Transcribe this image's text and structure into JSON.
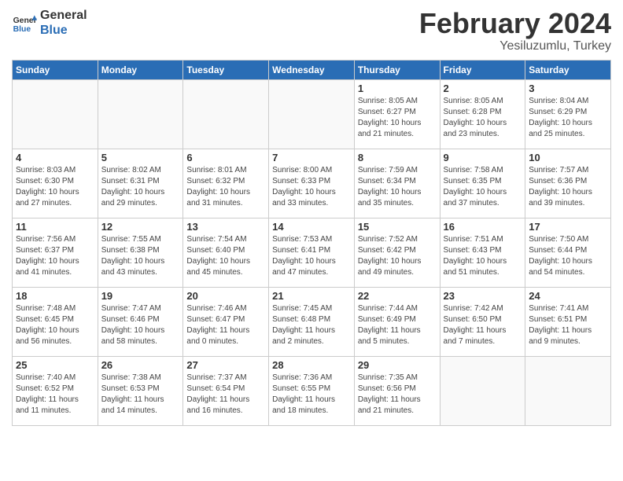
{
  "header": {
    "logo_line1": "General",
    "logo_line2": "Blue",
    "month": "February 2024",
    "location": "Yesiluzumlu, Turkey"
  },
  "weekdays": [
    "Sunday",
    "Monday",
    "Tuesday",
    "Wednesday",
    "Thursday",
    "Friday",
    "Saturday"
  ],
  "weeks": [
    [
      {
        "day": "",
        "info": ""
      },
      {
        "day": "",
        "info": ""
      },
      {
        "day": "",
        "info": ""
      },
      {
        "day": "",
        "info": ""
      },
      {
        "day": "1",
        "info": "Sunrise: 8:05 AM\nSunset: 6:27 PM\nDaylight: 10 hours\nand 21 minutes."
      },
      {
        "day": "2",
        "info": "Sunrise: 8:05 AM\nSunset: 6:28 PM\nDaylight: 10 hours\nand 23 minutes."
      },
      {
        "day": "3",
        "info": "Sunrise: 8:04 AM\nSunset: 6:29 PM\nDaylight: 10 hours\nand 25 minutes."
      }
    ],
    [
      {
        "day": "4",
        "info": "Sunrise: 8:03 AM\nSunset: 6:30 PM\nDaylight: 10 hours\nand 27 minutes."
      },
      {
        "day": "5",
        "info": "Sunrise: 8:02 AM\nSunset: 6:31 PM\nDaylight: 10 hours\nand 29 minutes."
      },
      {
        "day": "6",
        "info": "Sunrise: 8:01 AM\nSunset: 6:32 PM\nDaylight: 10 hours\nand 31 minutes."
      },
      {
        "day": "7",
        "info": "Sunrise: 8:00 AM\nSunset: 6:33 PM\nDaylight: 10 hours\nand 33 minutes."
      },
      {
        "day": "8",
        "info": "Sunrise: 7:59 AM\nSunset: 6:34 PM\nDaylight: 10 hours\nand 35 minutes."
      },
      {
        "day": "9",
        "info": "Sunrise: 7:58 AM\nSunset: 6:35 PM\nDaylight: 10 hours\nand 37 minutes."
      },
      {
        "day": "10",
        "info": "Sunrise: 7:57 AM\nSunset: 6:36 PM\nDaylight: 10 hours\nand 39 minutes."
      }
    ],
    [
      {
        "day": "11",
        "info": "Sunrise: 7:56 AM\nSunset: 6:37 PM\nDaylight: 10 hours\nand 41 minutes."
      },
      {
        "day": "12",
        "info": "Sunrise: 7:55 AM\nSunset: 6:38 PM\nDaylight: 10 hours\nand 43 minutes."
      },
      {
        "day": "13",
        "info": "Sunrise: 7:54 AM\nSunset: 6:40 PM\nDaylight: 10 hours\nand 45 minutes."
      },
      {
        "day": "14",
        "info": "Sunrise: 7:53 AM\nSunset: 6:41 PM\nDaylight: 10 hours\nand 47 minutes."
      },
      {
        "day": "15",
        "info": "Sunrise: 7:52 AM\nSunset: 6:42 PM\nDaylight: 10 hours\nand 49 minutes."
      },
      {
        "day": "16",
        "info": "Sunrise: 7:51 AM\nSunset: 6:43 PM\nDaylight: 10 hours\nand 51 minutes."
      },
      {
        "day": "17",
        "info": "Sunrise: 7:50 AM\nSunset: 6:44 PM\nDaylight: 10 hours\nand 54 minutes."
      }
    ],
    [
      {
        "day": "18",
        "info": "Sunrise: 7:48 AM\nSunset: 6:45 PM\nDaylight: 10 hours\nand 56 minutes."
      },
      {
        "day": "19",
        "info": "Sunrise: 7:47 AM\nSunset: 6:46 PM\nDaylight: 10 hours\nand 58 minutes."
      },
      {
        "day": "20",
        "info": "Sunrise: 7:46 AM\nSunset: 6:47 PM\nDaylight: 11 hours\nand 0 minutes."
      },
      {
        "day": "21",
        "info": "Sunrise: 7:45 AM\nSunset: 6:48 PM\nDaylight: 11 hours\nand 2 minutes."
      },
      {
        "day": "22",
        "info": "Sunrise: 7:44 AM\nSunset: 6:49 PM\nDaylight: 11 hours\nand 5 minutes."
      },
      {
        "day": "23",
        "info": "Sunrise: 7:42 AM\nSunset: 6:50 PM\nDaylight: 11 hours\nand 7 minutes."
      },
      {
        "day": "24",
        "info": "Sunrise: 7:41 AM\nSunset: 6:51 PM\nDaylight: 11 hours\nand 9 minutes."
      }
    ],
    [
      {
        "day": "25",
        "info": "Sunrise: 7:40 AM\nSunset: 6:52 PM\nDaylight: 11 hours\nand 11 minutes."
      },
      {
        "day": "26",
        "info": "Sunrise: 7:38 AM\nSunset: 6:53 PM\nDaylight: 11 hours\nand 14 minutes."
      },
      {
        "day": "27",
        "info": "Sunrise: 7:37 AM\nSunset: 6:54 PM\nDaylight: 11 hours\nand 16 minutes."
      },
      {
        "day": "28",
        "info": "Sunrise: 7:36 AM\nSunset: 6:55 PM\nDaylight: 11 hours\nand 18 minutes."
      },
      {
        "day": "29",
        "info": "Sunrise: 7:35 AM\nSunset: 6:56 PM\nDaylight: 11 hours\nand 21 minutes."
      },
      {
        "day": "",
        "info": ""
      },
      {
        "day": "",
        "info": ""
      }
    ]
  ]
}
